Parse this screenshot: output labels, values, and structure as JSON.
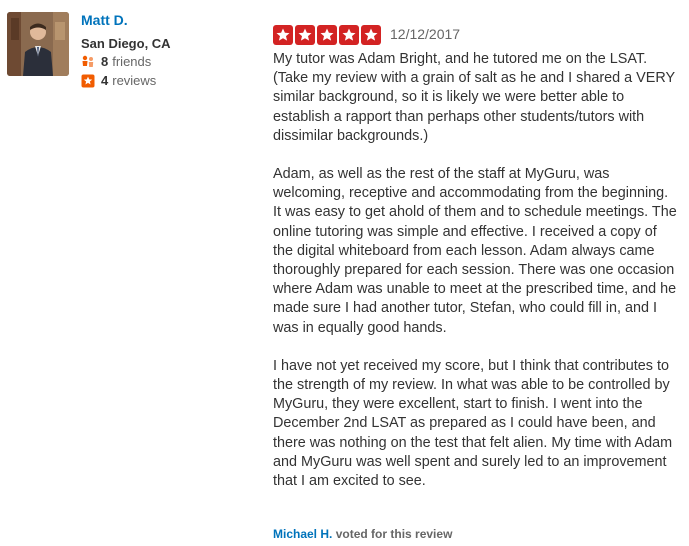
{
  "reviewer": {
    "name": "Matt D.",
    "location": "San Diego, CA",
    "friends_count": "8",
    "friends_label": "friends",
    "reviews_count": "4",
    "reviews_label": "reviews"
  },
  "review": {
    "rating": 5,
    "date": "12/12/2017",
    "paragraphs": [
      "My tutor was Adam Bright, and he tutored me on the LSAT. (Take my review with a grain of salt as he and I shared a VERY similar background, so it is likely we were better able to establish a rapport than perhaps other students/tutors with dissimilar backgrounds.)",
      "Adam, as well as the rest of the staff at MyGuru, was welcoming, receptive and accommodating from the beginning. It was easy to get ahold of them and to schedule meetings. The online tutoring was simple and effective. I received a copy of the digital whiteboard from each lesson. Adam always came thoroughly prepared for each session. There was one occasion where Adam was unable to meet at the prescribed time, and he made sure I had another tutor, Stefan, who could fill in, and I was in equally good hands.",
      "I have not yet received my score, but I think that contributes to the strength of my review. In what was able to be controlled by MyGuru, they were excellent, start to finish. I went into the December 2nd LSAT as prepared as I could have been, and there was nothing on the test that felt alien. My time with Adam and MyGuru was well spent and surely led to an improvement that I am excited to see."
    ]
  },
  "vote": {
    "voter": "Michael H.",
    "text": "voted for this review"
  },
  "colors": {
    "link": "#0073bb",
    "star": "#d32323",
    "friends_icon": "#f15c00",
    "reviews_icon": "#f15c00"
  },
  "icons": {
    "friends": "friends-icon",
    "reviews": "star-badge-icon",
    "star": "star-icon"
  }
}
